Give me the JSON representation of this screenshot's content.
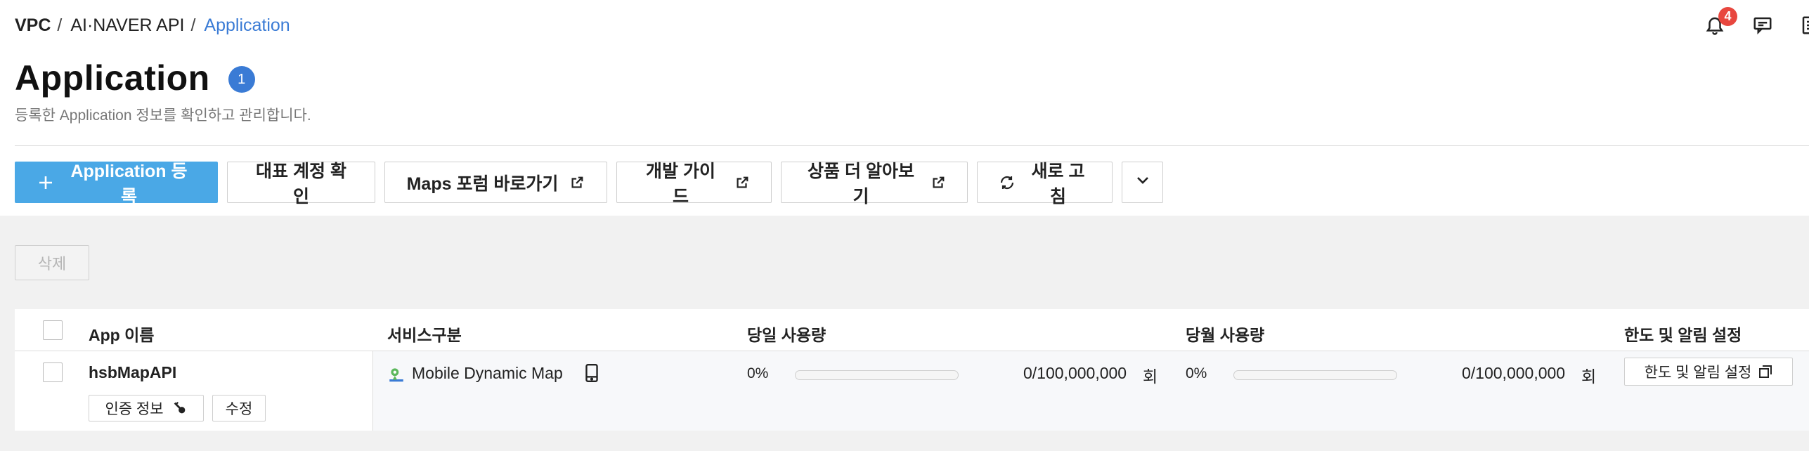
{
  "breadcrumb": {
    "items": [
      "VPC",
      "AI·NAVER API"
    ],
    "separator": "/",
    "current": "Application"
  },
  "notifications": {
    "count": "4"
  },
  "page": {
    "title": "Application",
    "count": "1",
    "description": "등록한 Application 정보를 확인하고 관리합니다."
  },
  "toolbar": {
    "register_label": "Application 등록",
    "main_account_label": "대표 계정 확인",
    "maps_forum_label": "Maps 포럼 바로가기",
    "dev_guide_label": "개발 가이드",
    "learn_more_label": "상품 더 알아보기",
    "refresh_label": "새로 고침"
  },
  "actions": {
    "delete_label": "삭제"
  },
  "table": {
    "columns": [
      "App 이름",
      "서비스구분",
      "당일 사용량",
      "당월 사용량",
      "한도 및 알림 설정"
    ],
    "rows": [
      {
        "app_name": "hsbMapAPI",
        "auth_label": "인증 정보",
        "edit_label": "수정",
        "service": "Mobile Dynamic Map",
        "daily_percent": "0%",
        "daily_usage": "0/100,000,000",
        "daily_unit": "회",
        "daily_fraction": 0,
        "monthly_percent": "0%",
        "monthly_usage": "0/100,000,000",
        "monthly_unit": "회",
        "monthly_fraction": 0,
        "limit_label": "한도 및 알림 설정"
      }
    ]
  },
  "colors": {
    "primary": "#4aa8e6",
    "link": "#3a7bd5",
    "badge": "#e8473f"
  }
}
